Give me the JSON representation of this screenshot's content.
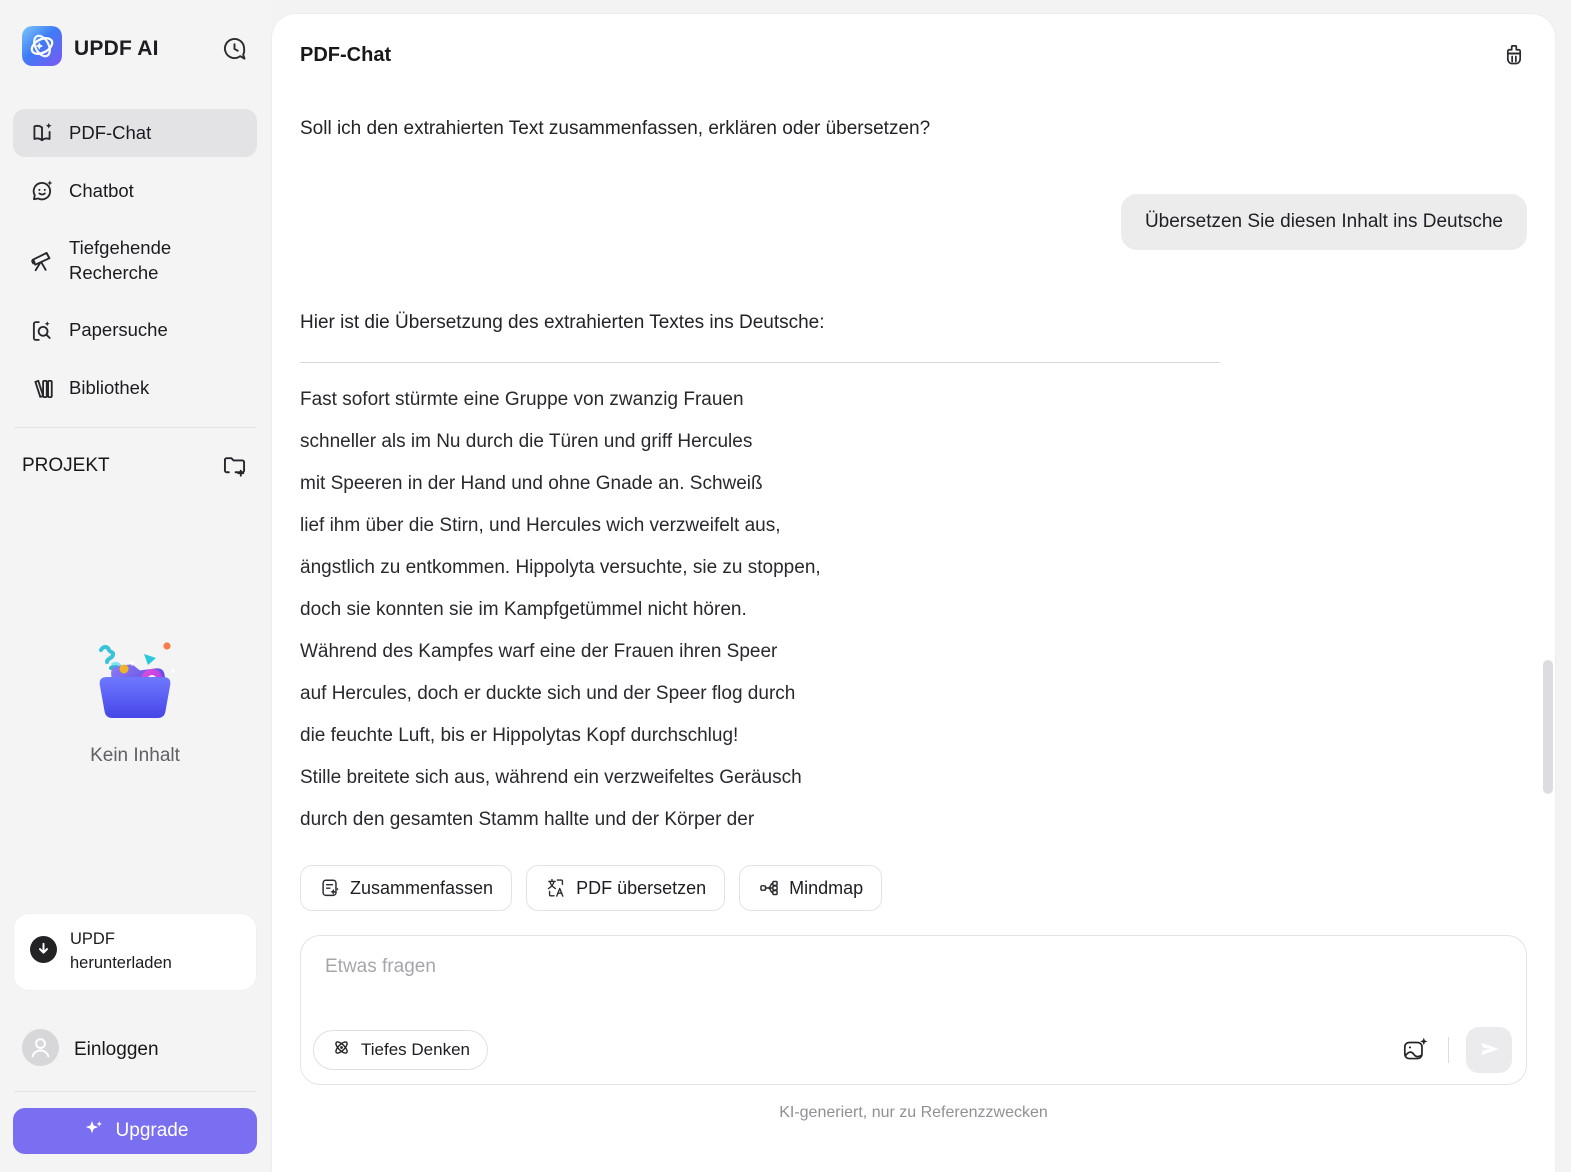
{
  "app": {
    "name": "UPDF AI"
  },
  "colors": {
    "accent_purple": "#7A6FF0",
    "sidebar_bg": "#F4F4F5",
    "active_item_bg": "#E3E3E6",
    "card_bg": "#FFFFFF",
    "user_bubble_bg": "#ECECED",
    "border": "#E4E4E7",
    "text_primary": "#1C1C21",
    "text_muted": "#8F9096",
    "logo_gradient": [
      "#7CC8F8",
      "#3E7BF6",
      "#7C58F2"
    ]
  },
  "sidebar": {
    "items": [
      {
        "label": "PDF-Chat",
        "active": true
      },
      {
        "label": "Chatbot",
        "active": false
      },
      {
        "label": "Tiefgehende Recherche",
        "active": false
      },
      {
        "label": "Papersuche",
        "active": false
      },
      {
        "label": "Bibliothek",
        "active": false
      }
    ],
    "project_label": "PROJEKT",
    "empty_label": "Kein Inhalt",
    "download_label": "UPDF herunterladen",
    "login_label": "Einloggen",
    "upgrade_label": "Upgrade"
  },
  "header": {
    "title": "PDF-Chat"
  },
  "chat": {
    "assistant_intro": "Soll ich den extrahierten Text zusammenfassen, erklären oder übersetzen?",
    "user_message": "Übersetzen Sie diesen Inhalt ins Deutsche",
    "translation_heading": "Hier ist die Übersetzung des extrahierten Textes ins Deutsche:",
    "translation_lines": [
      "Fast sofort stürmte eine Gruppe von zwanzig Frauen",
      "schneller als im Nu durch die Türen und griff Hercules",
      "mit Speeren in der Hand und ohne Gnade an. Schweiß",
      "lief ihm über die Stirn, und Hercules wich verzweifelt aus,",
      "ängstlich zu entkommen. Hippolyta versuchte, sie zu stoppen,",
      "doch sie konnten sie im Kampfgetümmel nicht hören.",
      "Während des Kampfes warf eine der Frauen ihren Speer",
      "auf Hercules, doch er duckte sich und der Speer flog durch",
      "die feuchte Luft, bis er Hippolytas Kopf durchschlug!",
      "Stille breitete sich aus, während ein verzweifeltes Geräusch",
      "durch den gesamten Stamm hallte und der Körper der"
    ]
  },
  "actions": {
    "summarize": "Zusammenfassen",
    "translate": "PDF übersetzen",
    "mindmap": "Mindmap"
  },
  "composer": {
    "placeholder": "Etwas fragen",
    "deep_think": "Tiefes Denken"
  },
  "footer": {
    "disclaimer": "KI-generiert, nur zu Referenzzwecken"
  },
  "icons": {
    "logo": "updf-swirl-orbits",
    "history": "chat-bubble-clock",
    "pdf_chat": "open-book-sparkle",
    "chatbot": "smiley-bubble-sparkle",
    "deep_research": "telescope",
    "paper_search": "document-magnifier-sparkle",
    "library": "book-spines",
    "add_project": "folder-plus",
    "empty_state": "open-folder-confetti-illustration",
    "download": "black-circle-arrow-down",
    "login": "person-avatar",
    "upgrade": "four-point-sparkles",
    "clear_chat": "cleaning-brush",
    "summarize": "document-sparkle",
    "translate": "language-characters",
    "mindmap": "node-tree",
    "deep_think": "atom",
    "image_upload": "image-sparkle",
    "send": "paper-plane"
  }
}
